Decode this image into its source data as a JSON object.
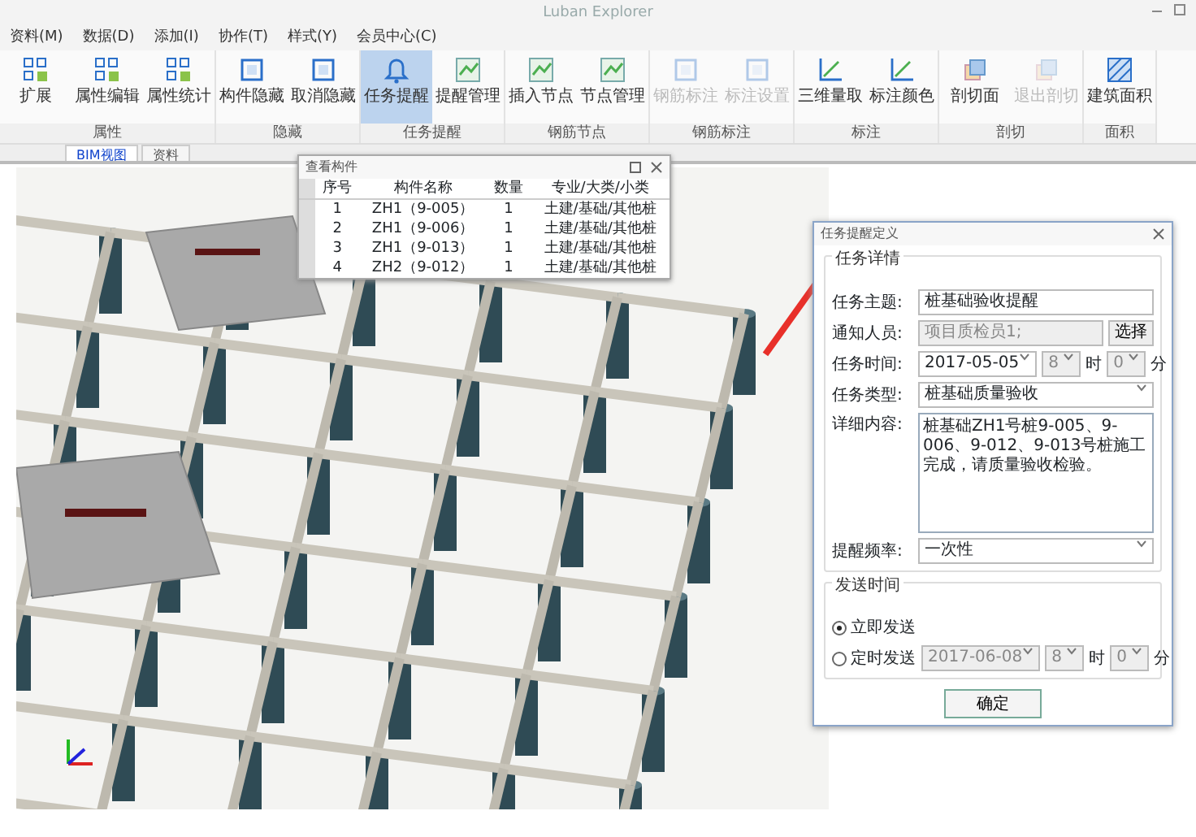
{
  "window": {
    "title": "Luban Explorer"
  },
  "menu": [
    "资料(M)",
    "数据(D)",
    "添加(I)",
    "协作(T)",
    "样式(Y)",
    "会员中心(C)"
  ],
  "ribbon": [
    {
      "label": "属性",
      "buttons": [
        {
          "label": "扩展",
          "selected": false,
          "disabled": false
        },
        {
          "label": "属性编辑",
          "selected": false,
          "disabled": false
        },
        {
          "label": "属性统计",
          "selected": false,
          "disabled": false
        }
      ]
    },
    {
      "label": "隐藏",
      "buttons": [
        {
          "label": "构件隐藏",
          "selected": false,
          "disabled": false
        },
        {
          "label": "取消隐藏",
          "selected": false,
          "disabled": false
        }
      ]
    },
    {
      "label": "任务提醒",
      "buttons": [
        {
          "label": "任务提醒",
          "selected": true,
          "disabled": false
        },
        {
          "label": "提醒管理",
          "selected": false,
          "disabled": false
        }
      ]
    },
    {
      "label": "钢筋节点",
      "buttons": [
        {
          "label": "插入节点",
          "selected": false,
          "disabled": false
        },
        {
          "label": "节点管理",
          "selected": false,
          "disabled": false
        }
      ]
    },
    {
      "label": "钢筋标注",
      "buttons": [
        {
          "label": "钢筋标注",
          "selected": false,
          "disabled": true
        },
        {
          "label": "标注设置",
          "selected": false,
          "disabled": true
        }
      ]
    },
    {
      "label": "标注",
      "buttons": [
        {
          "label": "三维量取",
          "selected": false,
          "disabled": false
        },
        {
          "label": "标注颜色",
          "selected": false,
          "disabled": false
        }
      ]
    },
    {
      "label": "剖切",
      "buttons": [
        {
          "label": "剖切面",
          "selected": false,
          "disabled": false
        },
        {
          "label": "退出剖切",
          "selected": false,
          "disabled": true
        }
      ]
    },
    {
      "label": "面积",
      "buttons": [
        {
          "label": "建筑面积",
          "selected": false,
          "disabled": false
        }
      ]
    }
  ],
  "tabs": [
    {
      "label": "BIM视图",
      "selected": true
    },
    {
      "label": "资料",
      "selected": false
    }
  ],
  "components_window": {
    "title": "查看构件",
    "columns": [
      "序号",
      "构件名称",
      "数量",
      "专业/大类/小类"
    ],
    "rows": [
      [
        "1",
        "ZH1（9-005）",
        "1",
        "土建/基础/其他桩"
      ],
      [
        "2",
        "ZH1（9-006）",
        "1",
        "土建/基础/其他桩"
      ],
      [
        "3",
        "ZH1（9-013）",
        "1",
        "土建/基础/其他桩"
      ],
      [
        "4",
        "ZH2（9-012）",
        "1",
        "土建/基础/其他桩"
      ]
    ]
  },
  "dialog": {
    "title": "任务提醒定义",
    "details_group": "任务详情",
    "subject_label": "任务主题:",
    "subject": "桩基础验收提醒",
    "notify_label": "通知人员:",
    "notify": "项目质检员1;",
    "select_button": "选择",
    "time_label": "任务时间:",
    "date": "2017-05-05",
    "hour": "8",
    "hour_label": "时",
    "minute": "0",
    "minute_label": "分",
    "type_label": "任务类型:",
    "type": "桩基础质量验收",
    "content_label": "详细内容:",
    "content": "桩基础ZH1号桩9-005、9-006、9-012、9-013号桩施工完成，请质量验收检验。",
    "frequency_label": "提醒频率:",
    "frequency": "一次性",
    "send_group": "发送时间",
    "send_options": [
      {
        "label": "立即发送",
        "selected": true
      },
      {
        "label": "定时发送",
        "selected": false
      }
    ],
    "send_date": "2017-06-08",
    "send_hour": "8",
    "send_hour_label": "时",
    "send_minute": "0",
    "send_minute_label": "分",
    "ok_button": "确定"
  }
}
